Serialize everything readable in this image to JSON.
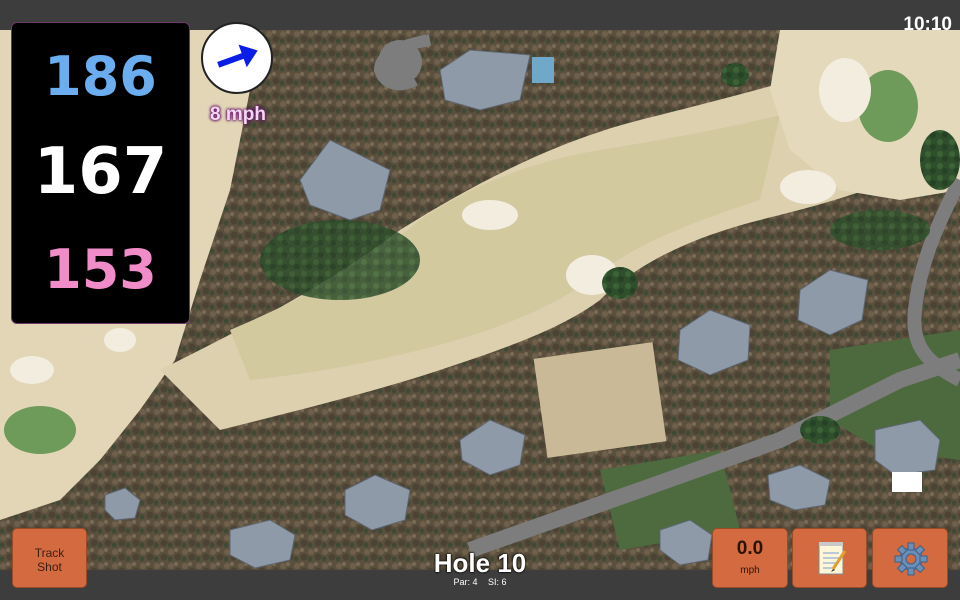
{
  "status": {
    "time": "10:10"
  },
  "distances": {
    "back": "186",
    "middle": "167",
    "front": "153"
  },
  "wind": {
    "speed_label": "8 mph",
    "icon": "arrow-icon",
    "arrow_color": "#0a1ee8"
  },
  "hole": {
    "title": "Hole 10",
    "par_label": "Par: 4",
    "si_label": "SI: 6"
  },
  "buttons": {
    "track_shot_line1": "Track",
    "track_shot_line2": "Shot",
    "speed_value": "0.0",
    "speed_unit": "mph",
    "notes_icon": "notepad-icon",
    "settings_icon": "gear-icon"
  },
  "colors": {
    "back": "#6aaef0",
    "middle": "#ffffff",
    "front": "#f08cc8",
    "button": "#d46a3f"
  }
}
